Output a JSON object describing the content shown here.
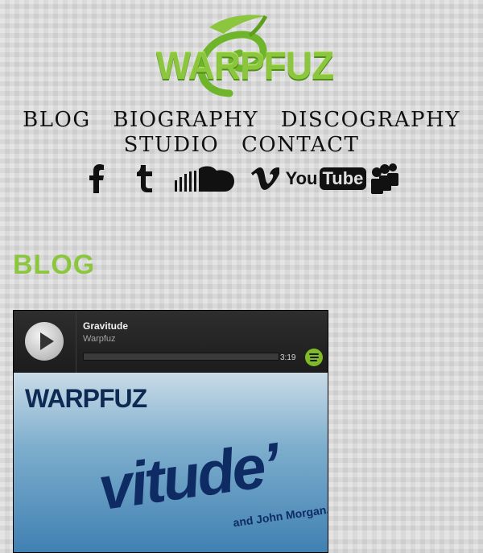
{
  "site": {
    "logo_text": "WARPFUZ",
    "logo_color": "#8cc63f"
  },
  "nav": {
    "row1": [
      "BLOG",
      "BIOGRAPHY",
      "DISCOGRAPHY"
    ],
    "row2": [
      "STUDIO",
      "CONTACT"
    ]
  },
  "social": {
    "icons": [
      "facebook-icon",
      "tumblr-icon",
      "soundcloud-icon",
      "vimeo-icon",
      "youtube-icon",
      "myspace-icon"
    ],
    "youtube_you": "You",
    "youtube_tube": "Tube"
  },
  "section": {
    "heading": "BLOG"
  },
  "player": {
    "track_title": "Gravitude",
    "artist": "Warpfuz",
    "duration": "3:19",
    "accent_color": "#7fbb27",
    "cover_band": "WARPFUZ",
    "cover_title": "vitude’",
    "cover_subtitle": "and John Morgan."
  }
}
